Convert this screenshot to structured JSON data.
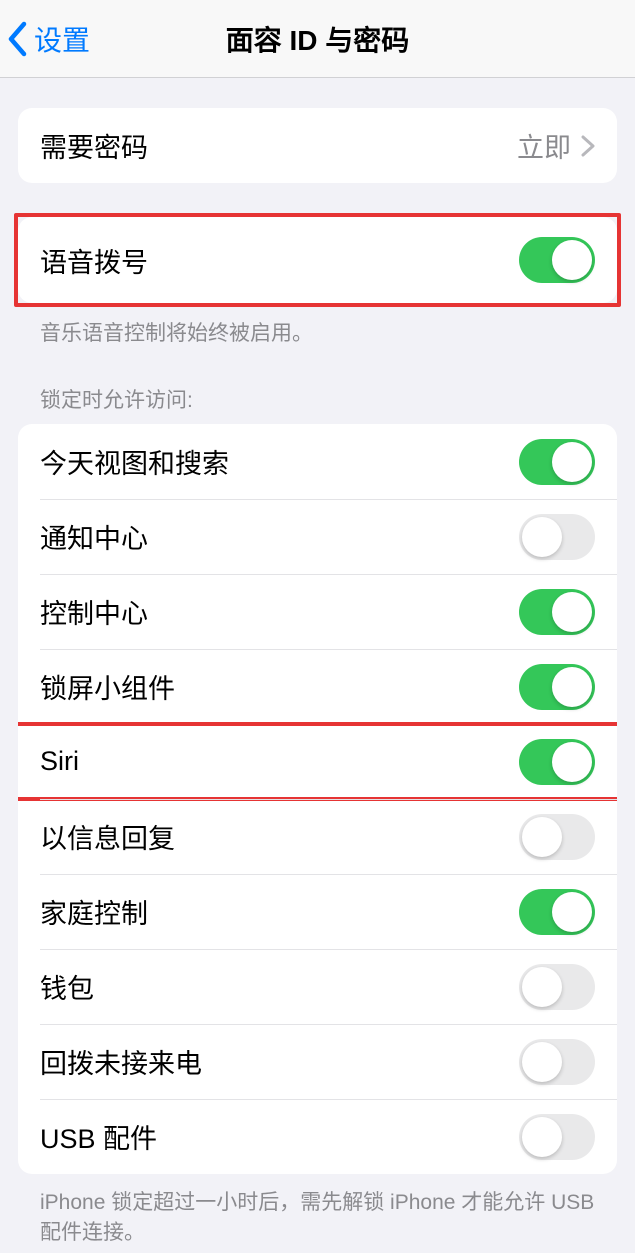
{
  "header": {
    "back": "设置",
    "title": "面容 ID 与密码"
  },
  "require_passcode": {
    "label": "需要密码",
    "value": "立即"
  },
  "voice_dial": {
    "label": "语音拨号",
    "on": true,
    "footer": "音乐语音控制将始终被启用。"
  },
  "lock_section": {
    "header": "锁定时允许访问:",
    "items": [
      {
        "label": "今天视图和搜索",
        "on": true
      },
      {
        "label": "通知中心",
        "on": false
      },
      {
        "label": "控制中心",
        "on": true
      },
      {
        "label": "锁屏小组件",
        "on": true
      },
      {
        "label": "Siri",
        "on": true,
        "highlight": true
      },
      {
        "label": "以信息回复",
        "on": false
      },
      {
        "label": "家庭控制",
        "on": true
      },
      {
        "label": "钱包",
        "on": false
      },
      {
        "label": "回拨未接来电",
        "on": false
      },
      {
        "label": "USB 配件",
        "on": false
      }
    ],
    "footer": "iPhone 锁定超过一小时后，需先解锁 iPhone 才能允许 USB 配件连接。"
  }
}
